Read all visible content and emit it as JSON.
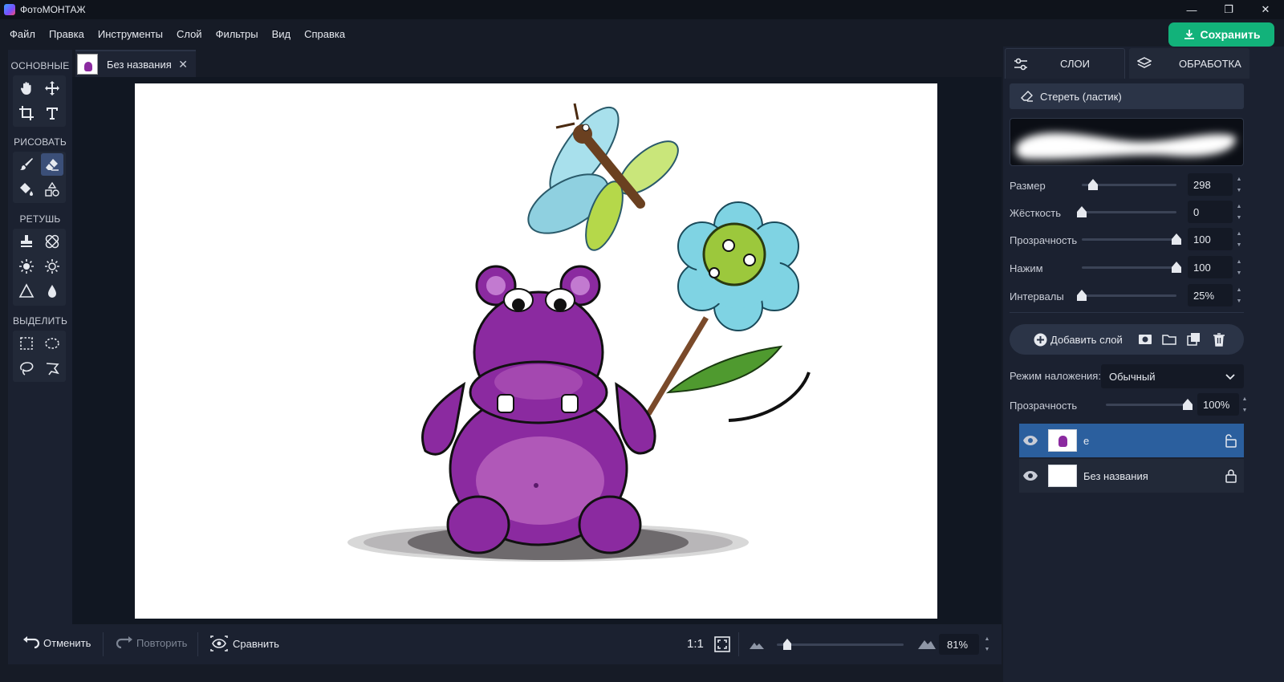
{
  "app": {
    "title": "ФотоМОНТАЖ"
  },
  "window": {
    "minimize": "—",
    "maximize": "❐",
    "close": "✕"
  },
  "menu": [
    "Файл",
    "Правка",
    "Инструменты",
    "Слой",
    "Фильтры",
    "Вид",
    "Справка"
  ],
  "save_button": "Сохранить",
  "toolbox": {
    "groups": [
      {
        "label": "ОСНОВНЫЕ",
        "tools": [
          "hand-icon",
          "move-icon",
          "crop-icon",
          "text-icon"
        ]
      },
      {
        "label": "РИСОВАТЬ",
        "tools": [
          "brush-icon",
          "eraser-icon",
          "fill-icon",
          "shapes-icon"
        ]
      },
      {
        "label": "РЕТУШЬ",
        "tools": [
          "stamp-icon",
          "patch-icon",
          "lighten-icon",
          "darken-icon",
          "sharpen-icon",
          "blur-icon"
        ]
      },
      {
        "label": "ВЫДЕЛИТЬ",
        "tools": [
          "rect-select-icon",
          "ellipse-select-icon",
          "lasso-icon",
          "polygon-lasso-icon"
        ]
      }
    ],
    "active_tool": "eraser-icon"
  },
  "document_tab": {
    "label": "Без названия",
    "close": "✕"
  },
  "bottom": {
    "undo": "Отменить",
    "redo": "Повторить",
    "compare": "Сравнить",
    "ratio": "1:1",
    "zoom_value": "81%",
    "zoom_level": 0.05
  },
  "right_panel": {
    "tabs": [
      {
        "label": "СЛОИ",
        "active": true
      },
      {
        "label": "ОБРАБОТКА",
        "active": false
      }
    ],
    "tool_mode": "Стереть (ластик)",
    "params": [
      {
        "label": "Размер",
        "value": "298",
        "level": 0.12
      },
      {
        "label": "Жёсткость",
        "value": "0",
        "level": 0.0
      },
      {
        "label": "Прозрачность",
        "value": "100",
        "level": 1.0
      },
      {
        "label": "Нажим",
        "value": "100",
        "level": 1.0
      },
      {
        "label": "Интервалы",
        "value": "25%",
        "level": 0.0
      }
    ],
    "add_layer": "Добавить слой",
    "blend_label": "Режим наложения:",
    "blend_value": "Обычный",
    "opacity_label": "Прозрачность",
    "opacity_value": "100%",
    "opacity_level": 1.0,
    "layers": [
      {
        "name": "е",
        "selected": true,
        "locked": false
      },
      {
        "name": "Без названия",
        "selected": false,
        "locked": true
      }
    ]
  },
  "colors": {
    "accent_green": "#12b27a",
    "selected_layer": "#2b5f9e",
    "hippo_purple": "#8b2aa0"
  }
}
